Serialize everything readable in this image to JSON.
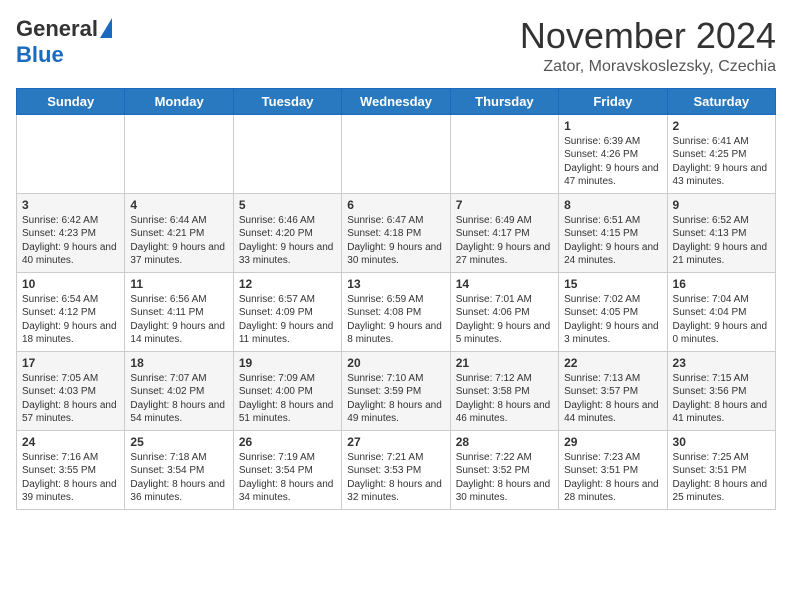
{
  "header": {
    "logo_general": "General",
    "logo_blue": "Blue",
    "month_title": "November 2024",
    "location": "Zator, Moravskoslezsky, Czechia"
  },
  "weekdays": [
    "Sunday",
    "Monday",
    "Tuesday",
    "Wednesday",
    "Thursday",
    "Friday",
    "Saturday"
  ],
  "weeks": [
    [
      {
        "day": "",
        "sunrise": "",
        "sunset": "",
        "daylight": ""
      },
      {
        "day": "",
        "sunrise": "",
        "sunset": "",
        "daylight": ""
      },
      {
        "day": "",
        "sunrise": "",
        "sunset": "",
        "daylight": ""
      },
      {
        "day": "",
        "sunrise": "",
        "sunset": "",
        "daylight": ""
      },
      {
        "day": "",
        "sunrise": "",
        "sunset": "",
        "daylight": ""
      },
      {
        "day": "1",
        "sunrise": "Sunrise: 6:39 AM",
        "sunset": "Sunset: 4:26 PM",
        "daylight": "Daylight: 9 hours and 47 minutes."
      },
      {
        "day": "2",
        "sunrise": "Sunrise: 6:41 AM",
        "sunset": "Sunset: 4:25 PM",
        "daylight": "Daylight: 9 hours and 43 minutes."
      }
    ],
    [
      {
        "day": "3",
        "sunrise": "Sunrise: 6:42 AM",
        "sunset": "Sunset: 4:23 PM",
        "daylight": "Daylight: 9 hours and 40 minutes."
      },
      {
        "day": "4",
        "sunrise": "Sunrise: 6:44 AM",
        "sunset": "Sunset: 4:21 PM",
        "daylight": "Daylight: 9 hours and 37 minutes."
      },
      {
        "day": "5",
        "sunrise": "Sunrise: 6:46 AM",
        "sunset": "Sunset: 4:20 PM",
        "daylight": "Daylight: 9 hours and 33 minutes."
      },
      {
        "day": "6",
        "sunrise": "Sunrise: 6:47 AM",
        "sunset": "Sunset: 4:18 PM",
        "daylight": "Daylight: 9 hours and 30 minutes."
      },
      {
        "day": "7",
        "sunrise": "Sunrise: 6:49 AM",
        "sunset": "Sunset: 4:17 PM",
        "daylight": "Daylight: 9 hours and 27 minutes."
      },
      {
        "day": "8",
        "sunrise": "Sunrise: 6:51 AM",
        "sunset": "Sunset: 4:15 PM",
        "daylight": "Daylight: 9 hours and 24 minutes."
      },
      {
        "day": "9",
        "sunrise": "Sunrise: 6:52 AM",
        "sunset": "Sunset: 4:13 PM",
        "daylight": "Daylight: 9 hours and 21 minutes."
      }
    ],
    [
      {
        "day": "10",
        "sunrise": "Sunrise: 6:54 AM",
        "sunset": "Sunset: 4:12 PM",
        "daylight": "Daylight: 9 hours and 18 minutes."
      },
      {
        "day": "11",
        "sunrise": "Sunrise: 6:56 AM",
        "sunset": "Sunset: 4:11 PM",
        "daylight": "Daylight: 9 hours and 14 minutes."
      },
      {
        "day": "12",
        "sunrise": "Sunrise: 6:57 AM",
        "sunset": "Sunset: 4:09 PM",
        "daylight": "Daylight: 9 hours and 11 minutes."
      },
      {
        "day": "13",
        "sunrise": "Sunrise: 6:59 AM",
        "sunset": "Sunset: 4:08 PM",
        "daylight": "Daylight: 9 hours and 8 minutes."
      },
      {
        "day": "14",
        "sunrise": "Sunrise: 7:01 AM",
        "sunset": "Sunset: 4:06 PM",
        "daylight": "Daylight: 9 hours and 5 minutes."
      },
      {
        "day": "15",
        "sunrise": "Sunrise: 7:02 AM",
        "sunset": "Sunset: 4:05 PM",
        "daylight": "Daylight: 9 hours and 3 minutes."
      },
      {
        "day": "16",
        "sunrise": "Sunrise: 7:04 AM",
        "sunset": "Sunset: 4:04 PM",
        "daylight": "Daylight: 9 hours and 0 minutes."
      }
    ],
    [
      {
        "day": "17",
        "sunrise": "Sunrise: 7:05 AM",
        "sunset": "Sunset: 4:03 PM",
        "daylight": "Daylight: 8 hours and 57 minutes."
      },
      {
        "day": "18",
        "sunrise": "Sunrise: 7:07 AM",
        "sunset": "Sunset: 4:02 PM",
        "daylight": "Daylight: 8 hours and 54 minutes."
      },
      {
        "day": "19",
        "sunrise": "Sunrise: 7:09 AM",
        "sunset": "Sunset: 4:00 PM",
        "daylight": "Daylight: 8 hours and 51 minutes."
      },
      {
        "day": "20",
        "sunrise": "Sunrise: 7:10 AM",
        "sunset": "Sunset: 3:59 PM",
        "daylight": "Daylight: 8 hours and 49 minutes."
      },
      {
        "day": "21",
        "sunrise": "Sunrise: 7:12 AM",
        "sunset": "Sunset: 3:58 PM",
        "daylight": "Daylight: 8 hours and 46 minutes."
      },
      {
        "day": "22",
        "sunrise": "Sunrise: 7:13 AM",
        "sunset": "Sunset: 3:57 PM",
        "daylight": "Daylight: 8 hours and 44 minutes."
      },
      {
        "day": "23",
        "sunrise": "Sunrise: 7:15 AM",
        "sunset": "Sunset: 3:56 PM",
        "daylight": "Daylight: 8 hours and 41 minutes."
      }
    ],
    [
      {
        "day": "24",
        "sunrise": "Sunrise: 7:16 AM",
        "sunset": "Sunset: 3:55 PM",
        "daylight": "Daylight: 8 hours and 39 minutes."
      },
      {
        "day": "25",
        "sunrise": "Sunrise: 7:18 AM",
        "sunset": "Sunset: 3:54 PM",
        "daylight": "Daylight: 8 hours and 36 minutes."
      },
      {
        "day": "26",
        "sunrise": "Sunrise: 7:19 AM",
        "sunset": "Sunset: 3:54 PM",
        "daylight": "Daylight: 8 hours and 34 minutes."
      },
      {
        "day": "27",
        "sunrise": "Sunrise: 7:21 AM",
        "sunset": "Sunset: 3:53 PM",
        "daylight": "Daylight: 8 hours and 32 minutes."
      },
      {
        "day": "28",
        "sunrise": "Sunrise: 7:22 AM",
        "sunset": "Sunset: 3:52 PM",
        "daylight": "Daylight: 8 hours and 30 minutes."
      },
      {
        "day": "29",
        "sunrise": "Sunrise: 7:23 AM",
        "sunset": "Sunset: 3:51 PM",
        "daylight": "Daylight: 8 hours and 28 minutes."
      },
      {
        "day": "30",
        "sunrise": "Sunrise: 7:25 AM",
        "sunset": "Sunset: 3:51 PM",
        "daylight": "Daylight: 8 hours and 25 minutes."
      }
    ]
  ]
}
